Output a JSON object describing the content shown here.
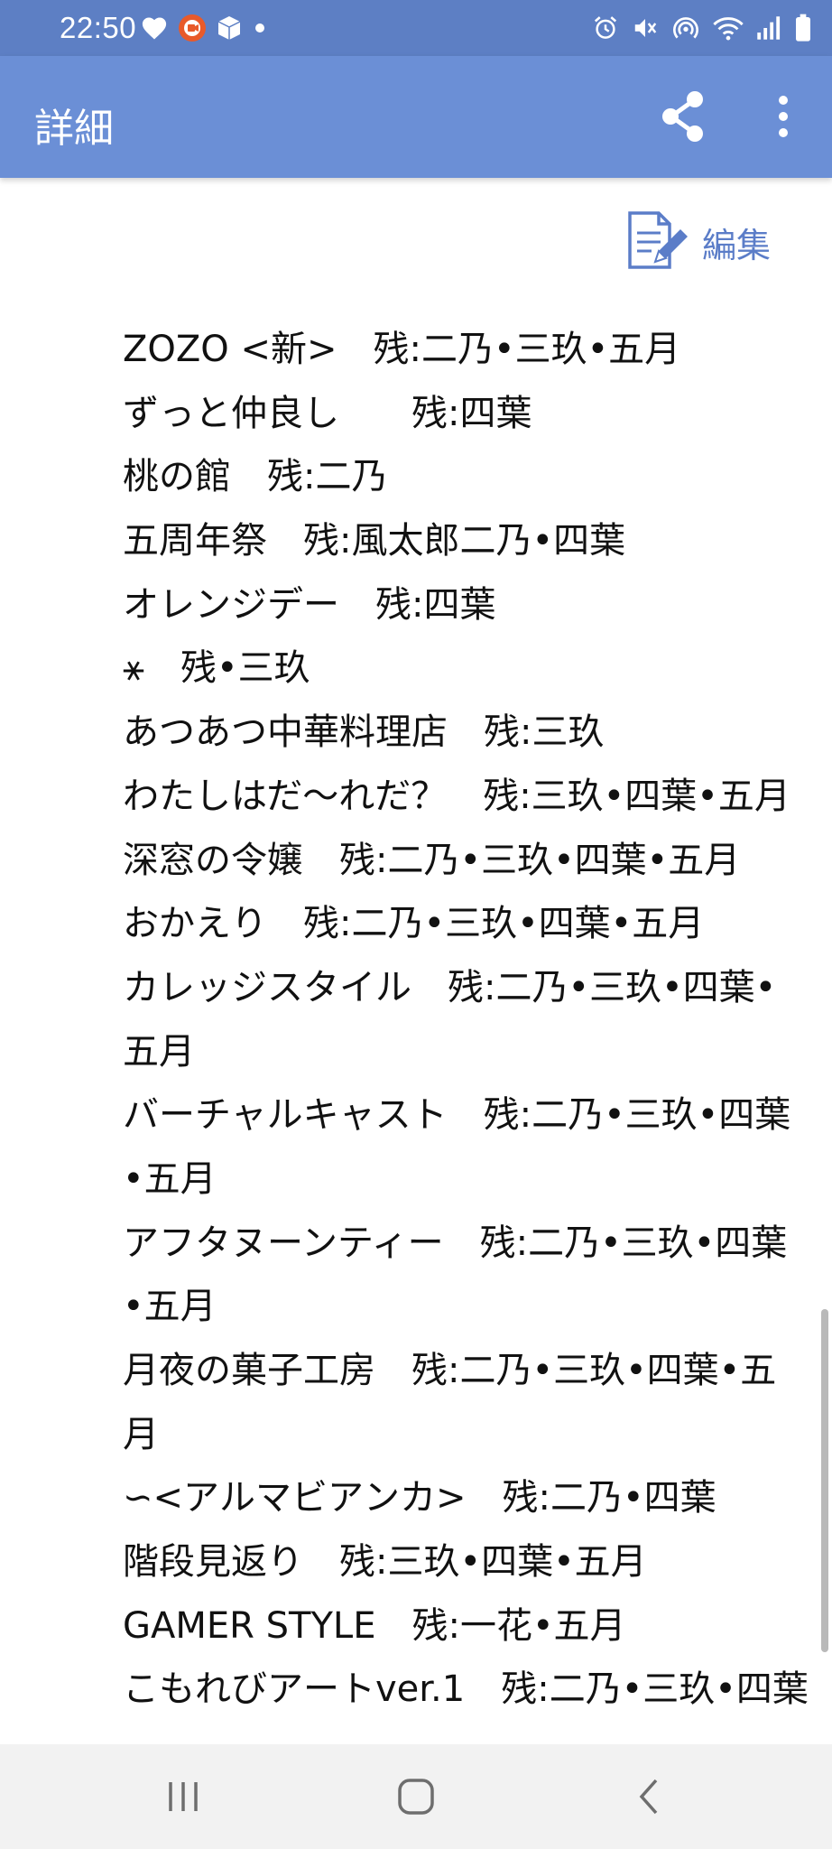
{
  "status_bar": {
    "time": "22:50"
  },
  "app_bar": {
    "title": "詳細",
    "share_icon": "share-icon",
    "more_icon": "more-vert-icon"
  },
  "edit": {
    "label": "編集",
    "icon": "edit-note-icon"
  },
  "lines": [
    "ZOZO <新>　残:二乃•三玖•五月",
    "ずっと仲良し　　残:四葉",
    "桃の館　残:二乃",
    "五周年祭　残:風太郎二乃•四葉",
    "オレンジデー　残:四葉",
    "⚹　残•三玖",
    "あつあつ中華料理店　残:三玖",
    "わたしはだ〜れだ？　残:三玖•四葉•五月",
    "深窓の令嬢　残:二乃•三玖•四葉•五月",
    "おかえり　残:二乃•三玖•四葉•五月",
    "カレッジスタイル　残:二乃•三玖•四葉•",
    "五月",
    "バーチャルキャスト　残:二乃•三玖•四葉",
    "•五月",
    "アフタヌーンティー　残:二乃•三玖•四葉",
    "•五月",
    "月夜の菓子工房　残:二乃•三玖•四葉•五",
    "月",
    "∽<アルマビアンカ>　残:二乃•四葉",
    "階段見返り　残:三玖•四葉•五月",
    "GAMER STYLE　残:一花•五月",
    "こもれびアートver.1　残:二乃•三玖•四葉"
  ],
  "colors": {
    "status_bar": "#5d7fc4",
    "app_bar": "#6b8fd6",
    "accent": "#5b7dc8"
  }
}
